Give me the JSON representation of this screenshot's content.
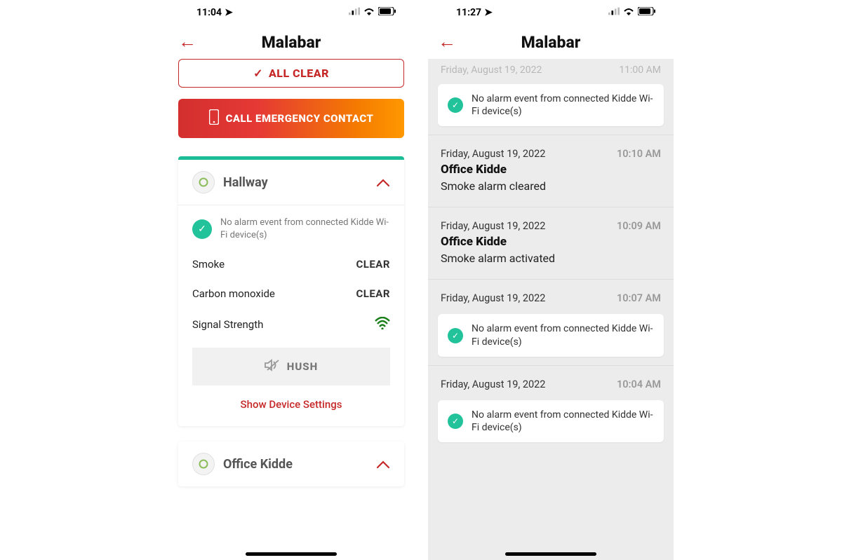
{
  "left": {
    "status": {
      "time": "11:04"
    },
    "title": "Malabar",
    "all_clear": "ALL CLEAR",
    "call_btn": "CALL EMERGENCY CONTACT",
    "devices": [
      {
        "name": "Hallway",
        "no_alarm": "No alarm event from connected Kidde Wi-Fi device(s)",
        "smoke_label": "Smoke",
        "smoke_status": "CLEAR",
        "co_label": "Carbon monoxide",
        "co_status": "CLEAR",
        "signal_label": "Signal Strength",
        "hush": "HUSH",
        "settings_link": "Show Device Settings"
      },
      {
        "name": "Office Kidde"
      }
    ]
  },
  "right": {
    "status": {
      "time": "11:27"
    },
    "title": "Malabar",
    "partial": {
      "date": "Friday, August 19, 2022",
      "time": "11:00 AM"
    },
    "pill_text": "No alarm event from connected Kidde Wi-Fi device(s)",
    "events": [
      {
        "date": "Friday, August 19, 2022",
        "time": "10:10 AM",
        "device": "Office Kidde",
        "msg": "Smoke alarm cleared"
      },
      {
        "date": "Friday, August 19, 2022",
        "time": "10:09 AM",
        "device": "Office Kidde",
        "msg": "Smoke alarm activated"
      },
      {
        "date": "Friday, August 19, 2022",
        "time": "10:07 AM",
        "pill": "No alarm event from connected Kidde Wi-Fi device(s)"
      },
      {
        "date": "Friday, August 19, 2022",
        "time": "10:04 AM",
        "pill": "No alarm event from connected Kidde Wi-Fi device(s)"
      }
    ]
  }
}
